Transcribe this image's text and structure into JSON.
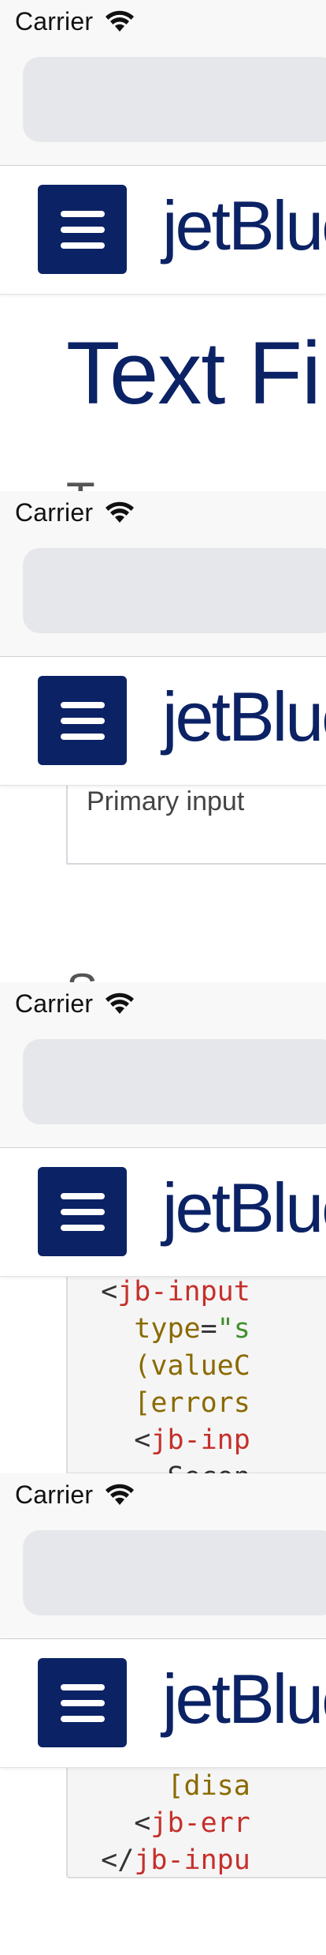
{
  "status_bar": {
    "carrier": "Carrier"
  },
  "header": {
    "brand": "jetBlue"
  },
  "page": {
    "title": "Text Fi",
    "subtitle_fragment": "T"
  },
  "input_demo": {
    "label_fragment": "Primary input",
    "section_fragment": "S"
  },
  "code_snippet_1": [
    {
      "indent": "  ",
      "parts": [
        {
          "t": "<",
          "c": "punct"
        },
        {
          "t": "jb-input",
          "c": "tag"
        }
      ]
    },
    {
      "indent": "    ",
      "parts": [
        {
          "t": "type",
          "c": "attr"
        },
        {
          "t": "=",
          "c": "punct"
        },
        {
          "t": "\"s",
          "c": "str"
        }
      ]
    },
    {
      "indent": "    ",
      "parts": [
        {
          "t": "(valueC",
          "c": "attr"
        }
      ]
    },
    {
      "indent": "    ",
      "parts": [
        {
          "t": "[errors",
          "c": "attr"
        }
      ]
    },
    {
      "indent": "    ",
      "parts": [
        {
          "t": "<",
          "c": "punct"
        },
        {
          "t": "jb-inp",
          "c": "tag"
        }
      ]
    },
    {
      "indent": "      ",
      "parts": [
        {
          "t": "Secon",
          "c": "punct"
        }
      ]
    }
  ],
  "code_snippet_2": [
    {
      "indent": "      ",
      "parts": [
        {
          "t": "[disa",
          "c": "attr"
        }
      ]
    },
    {
      "indent": "    ",
      "parts": [
        {
          "t": "<",
          "c": "punct"
        },
        {
          "t": "jb-err",
          "c": "tag"
        }
      ]
    },
    {
      "indent": "  ",
      "parts": [
        {
          "t": "</",
          "c": "punct"
        },
        {
          "t": "jb-inpu",
          "c": "tag"
        }
      ]
    }
  ],
  "colors": {
    "brand_navy": "#0b2265",
    "lock_red": "#e4002b",
    "code_tag": "#c5302b",
    "code_attr": "#8a6a00",
    "code_str": "#3f8f2f"
  },
  "icons": {
    "wifi": "wifi-icon",
    "lock": "lock-icon",
    "menu": "hamburger-menu-icon"
  }
}
